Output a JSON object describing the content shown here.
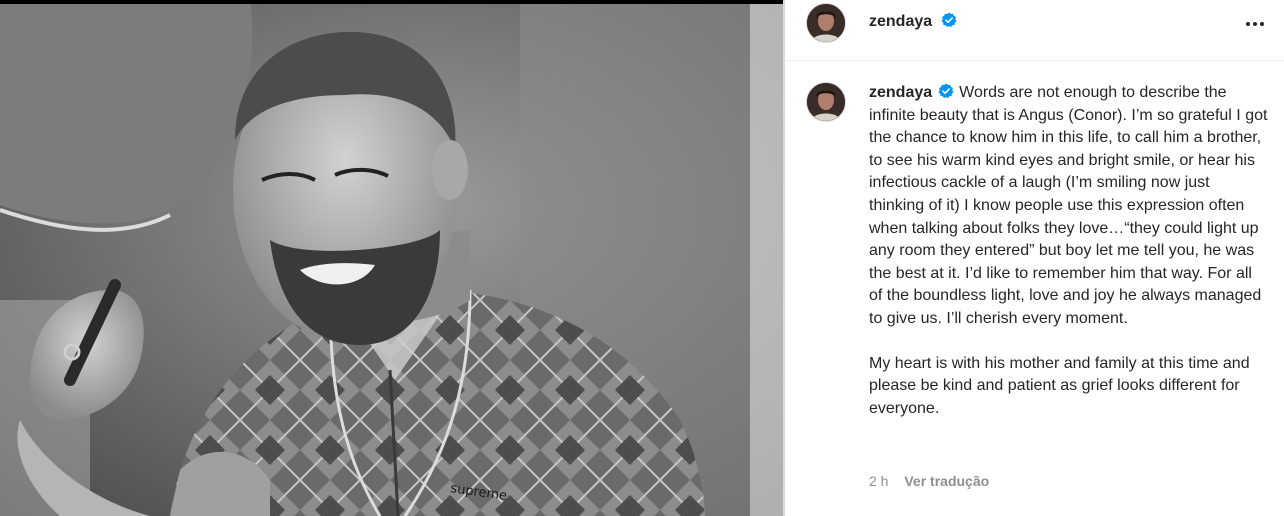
{
  "post": {
    "username": "zendaya",
    "verified_icon": "verified-badge-icon",
    "more_icon": "more-options-icon",
    "caption_paragraph_1": "Words are not enough to describe the infinite beauty that is Angus (Conor). I’m so grateful I got the chance to know him in this life, to call him a brother, to see his warm kind eyes and bright smile, or hear his infectious cackle of a laugh (I’m smiling now just thinking of it) I know people use this expression often when talking about folks they love…“they could light up any room they entered” but boy let me tell you, he was the best at it. I’d like to remember him that way. For all of the boundless light, love and joy he always managed to give us. I’ll cherish every moment.",
    "caption_paragraph_2": "My heart is with his mother and family at this time and please be kind and patient as grief looks different for everyone.",
    "timestamp": "2 h",
    "translate_label": "Ver tradução"
  },
  "colors": {
    "verified": "#0095f6",
    "secondary_text": "#8e8e8e",
    "border": "#dbdbdb"
  }
}
